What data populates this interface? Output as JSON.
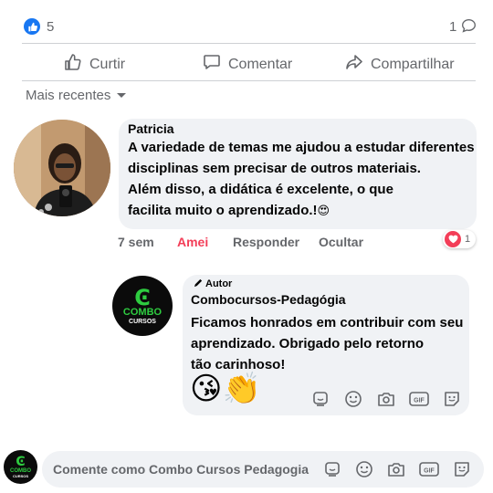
{
  "stats": {
    "likes": "5",
    "comments": "1"
  },
  "actions": {
    "like": "Curtir",
    "comment": "Comentar",
    "share": "Compartilhar"
  },
  "sort": {
    "label": "Mais recentes"
  },
  "comment": {
    "author": "Patricia",
    "text": "A variedade de temas me ajudou a estudar diferentes\ndisciplinas sem precisar de outros materiais.\nAlém disso, a didática é excelente, o que\nfacilita muito o aprendizado.!",
    "emoji": "😍",
    "time": "7 sem",
    "reaction_label": "Amei",
    "reply": "Responder",
    "hide": "Ocultar",
    "reaction_count": "1"
  },
  "reply": {
    "badge": "Autor",
    "author": "Combocursos-Pedagógia",
    "text": "Ficamos honrados em contribuir com seu\n aprendizado. Obrigado pelo retorno\ntão carinhoso!",
    "emojis": "😘👏"
  },
  "logo": {
    "line1": "COMBO",
    "line2": "CURSOS"
  },
  "composer": {
    "placeholder": "Comente como Combo Cursos Pedagogia"
  },
  "colors": {
    "accent": "#1877f2",
    "love": "#f33e58",
    "bubble": "#f0f2f5",
    "logo_green": "#2ecc40"
  },
  "icons": [
    "like-icon",
    "comment-icon",
    "share-icon",
    "caret-down-icon",
    "heart-icon",
    "pencil-icon",
    "sticker-icon",
    "emoji-icon",
    "camera-icon",
    "gif-icon",
    "avatar-sticker-icon"
  ]
}
